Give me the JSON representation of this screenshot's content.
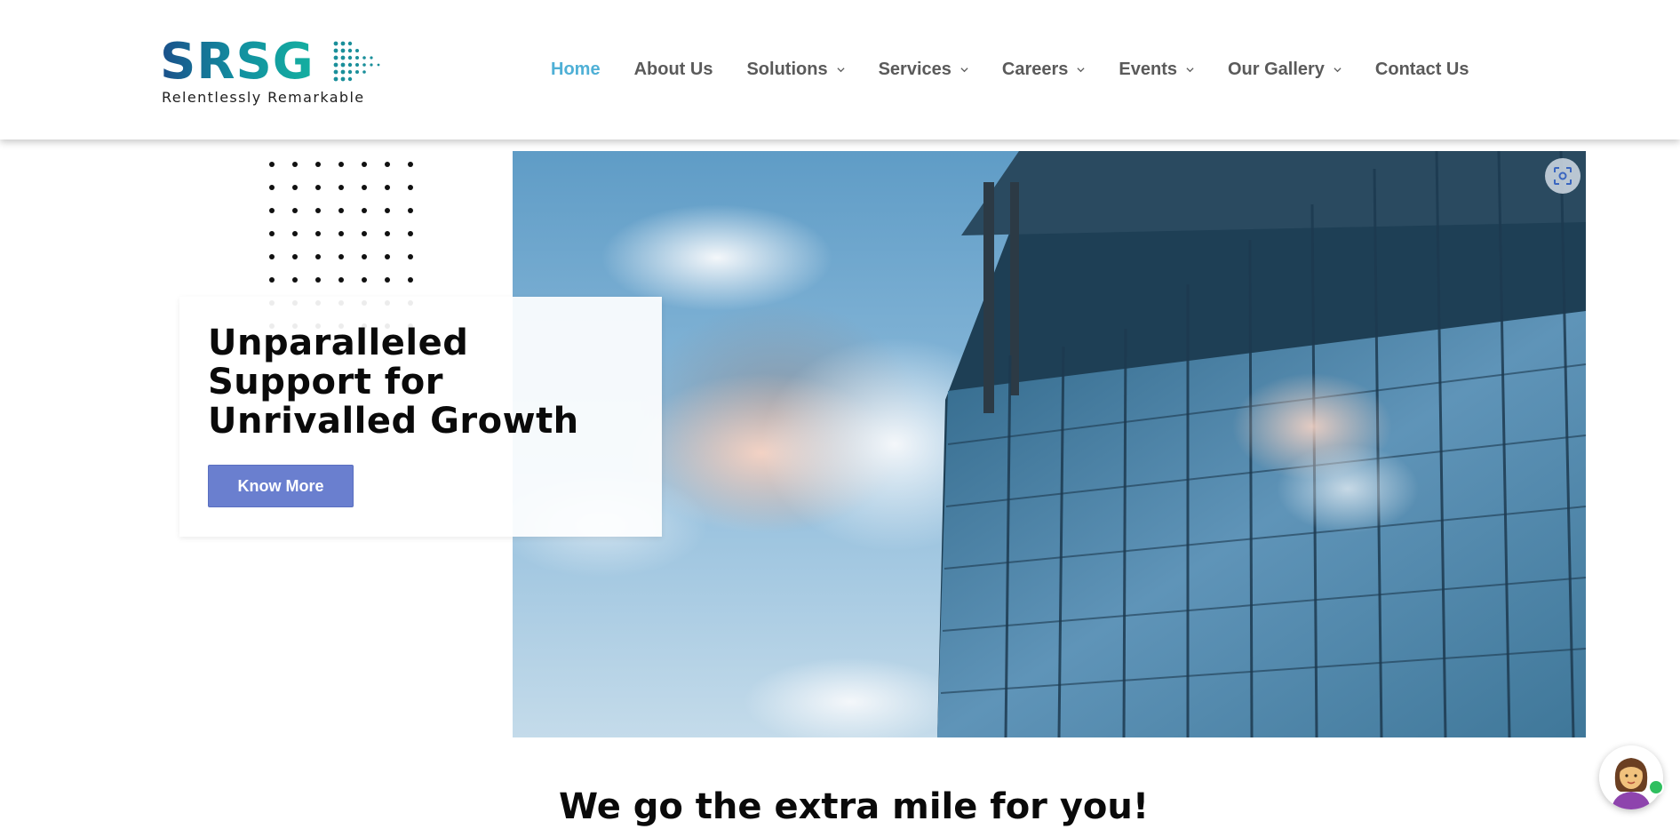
{
  "brand": {
    "name": "SRSG",
    "tagline": "Relentlessly Remarkable"
  },
  "nav": {
    "items": [
      {
        "label": "Home",
        "active": true,
        "has_dropdown": false
      },
      {
        "label": "About Us",
        "active": false,
        "has_dropdown": false
      },
      {
        "label": "Solutions",
        "active": false,
        "has_dropdown": true
      },
      {
        "label": "Services",
        "active": false,
        "has_dropdown": true
      },
      {
        "label": "Careers",
        "active": false,
        "has_dropdown": true
      },
      {
        "label": "Events",
        "active": false,
        "has_dropdown": true
      },
      {
        "label": "Our Gallery",
        "active": false,
        "has_dropdown": true
      },
      {
        "label": "Contact Us",
        "active": false,
        "has_dropdown": false
      }
    ]
  },
  "hero": {
    "title": "Unparalleled Support for Unrivalled Growth",
    "cta_label": "Know More"
  },
  "section": {
    "heading": "We go the extra mile for you!"
  },
  "icons": {
    "screenshot": "screenshot-capture-icon",
    "chat": "chat-agent-avatar-icon",
    "chevron": "chevron-down-icon"
  },
  "colors": {
    "nav_active": "#4fb0d6",
    "nav_text": "#5a5a5a",
    "cta_background": "#6a7fcf",
    "logo_gradient_start": "#1a4f8a",
    "logo_gradient_end": "#14b0a0",
    "online_status": "#2fbf5f"
  }
}
